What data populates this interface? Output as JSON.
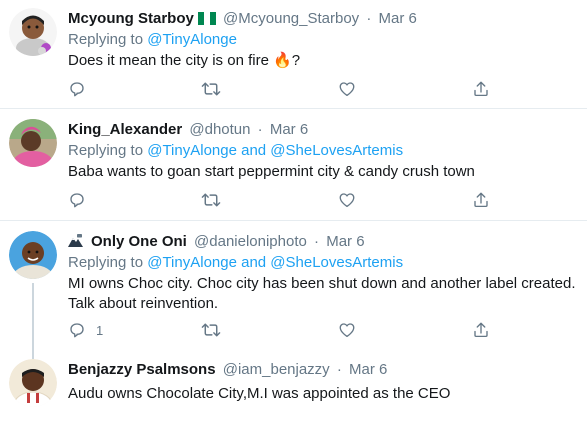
{
  "tweets": [
    {
      "name": "Mcyoung Starboy",
      "handle": "@Mcyoung_Starboy",
      "separator": "·",
      "date": "Mar 6",
      "replying_prefix": "Replying to",
      "replying_to": "@TinyAlonge",
      "text_before_emoji": "Does it mean the city is on fire ",
      "emoji": "🔥",
      "text_after_emoji": "?",
      "reply_count": "",
      "name_badge": "nigeria-flag-icon"
    },
    {
      "name": "King_Alexander",
      "handle": "@dhotun",
      "separator": "·",
      "date": "Mar 6",
      "replying_prefix": "Replying to",
      "replying_to": "@TinyAlonge and @SheLovesArtemis",
      "text": "Baba wants to goan start peppermint city & candy crush town",
      "reply_count": ""
    },
    {
      "name": "Only One Oni",
      "handle": "@danieloniphoto",
      "separator": "·",
      "date": "Mar 6",
      "replying_prefix": "Replying to",
      "replying_to": "@TinyAlonge and @SheLovesArtemis",
      "text_line1": "MI owns Choc city. Choc city has been shut down and another label created.",
      "text_line2": "Talk about reinvention.",
      "reply_count": "1",
      "name_prefix_icon": "mountain-camera-icon"
    },
    {
      "name": "Benjazzy Psalmsons",
      "handle": "@iam_benjazzy",
      "separator": "·",
      "date": "Mar 6",
      "text": "Audu owns Chocolate City,M.I was appointed as the CEO"
    }
  ],
  "colors": {
    "link": "#1da1f2",
    "muted": "#657786",
    "separator": "#e6ecf0",
    "thread_line": "#ccd6dd"
  },
  "icons": [
    "reply-icon",
    "retweet-icon",
    "like-icon",
    "share-icon"
  ]
}
